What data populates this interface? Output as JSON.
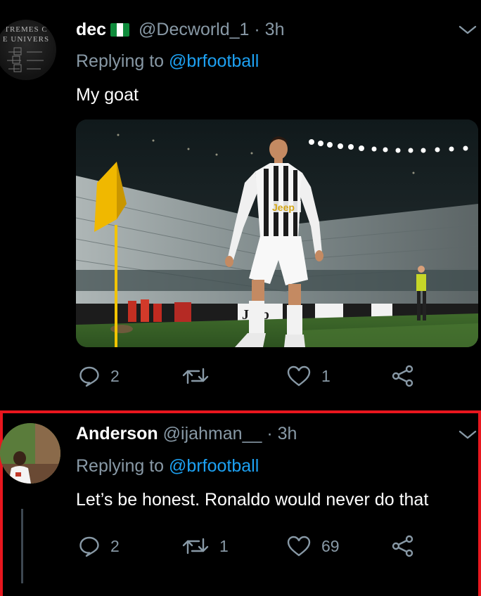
{
  "tweets": [
    {
      "name": "dec",
      "flag": "nigeria-flag",
      "handle": "@Decworld_1",
      "separator": "·",
      "time": "3h",
      "replying_prefix": "Replying to",
      "replying_to": "@brfootball",
      "text": "My goat",
      "avatar_text": [
        "TREMES C",
        "E UNIVERS"
      ],
      "media": {
        "shirt_text": "Jeep",
        "board_text": "Jeep"
      },
      "actions": {
        "reply": "2",
        "retweet": "",
        "like": "1",
        "share": ""
      }
    },
    {
      "name": "Anderson",
      "handle": "@ijahman__",
      "separator": "·",
      "time": "3h",
      "replying_prefix": "Replying to",
      "replying_to": "@brfootball",
      "text": "Let’s be honest. Ronaldo would never do that",
      "actions": {
        "reply": "2",
        "retweet": "1",
        "like": "69",
        "share": ""
      }
    }
  ],
  "colors": {
    "background": "#000000",
    "secondary_text": "#8899a6",
    "mention": "#1da1f2",
    "highlight_border": "#e8161e"
  }
}
